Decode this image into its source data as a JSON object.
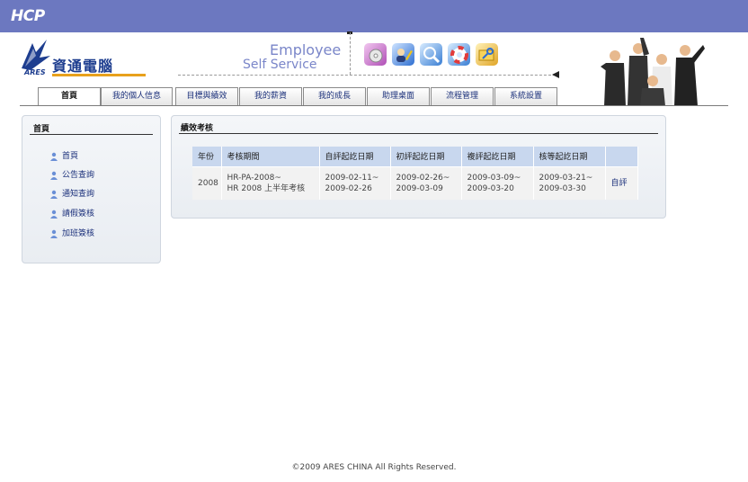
{
  "topbar": {
    "brand": "HCP"
  },
  "header": {
    "company": "資通電腦",
    "company_sub": "ARES",
    "ess_line1": "Employee",
    "ess_line2": "Self Service",
    "tool_icons": [
      "cd-icon",
      "edit-user-icon",
      "search-icon",
      "help-lifebuoy-icon",
      "key-folder-icon"
    ],
    "accent": "#e8a11c"
  },
  "nav": {
    "tabs": [
      "首頁",
      "我的個人信息",
      "目標與績效",
      "我的薪資",
      "我的成長",
      "助理桌面",
      "流程管理",
      "系統設置"
    ],
    "active": "首頁"
  },
  "sidebar": {
    "title": "首頁",
    "items": [
      "首頁",
      "公告查詢",
      "通知查詢",
      "請假簽核",
      "加班簽核"
    ]
  },
  "main": {
    "title": "績效考核",
    "columns": [
      "年份",
      "考核期間",
      "自評起訖日期",
      "初評起訖日期",
      "複評起訖日期",
      "核等起訖日期",
      ""
    ],
    "rows": [
      {
        "year": "2008",
        "period_l1": "HR-PA-2008~",
        "period_l2": "HR 2008 上半年考核",
        "self_l1": "2009-02-11~",
        "self_l2": "2009-02-26",
        "first_l1": "2009-02-26~",
        "first_l2": "2009-03-09",
        "review_l1": "2009-03-09~",
        "review_l2": "2009-03-20",
        "grade_l1": "2009-03-21~",
        "grade_l2": "2009-03-30",
        "action": "自評"
      }
    ]
  },
  "footer": {
    "text": "©2009 ARES CHINA All Rights Reserved."
  },
  "colors": {
    "topbar": "#6c78c0",
    "table_header": "#c8d7ee",
    "link": "#1a2f7a"
  }
}
